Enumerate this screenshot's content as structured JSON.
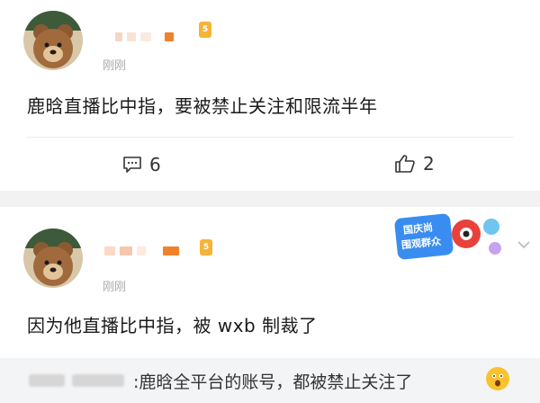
{
  "comments": [
    {
      "time": "刚刚",
      "content": "鹿晗直播比中指，要被禁止关注和限流半年",
      "level": "5",
      "comment_count": "6",
      "like_count": "2"
    },
    {
      "time": "刚刚",
      "content": "因为他直播比中指，被 wxb 制裁了",
      "level": "5"
    }
  ],
  "badge": {
    "line1": "国庆尚",
    "line2": "围观群众"
  },
  "reply": {
    "text": ":鹿晗全平台的账号，都被禁止关注了"
  },
  "colors": {
    "accent_orange": "#f0822c",
    "level": "#f5b437",
    "background": "#f2f2f2"
  }
}
